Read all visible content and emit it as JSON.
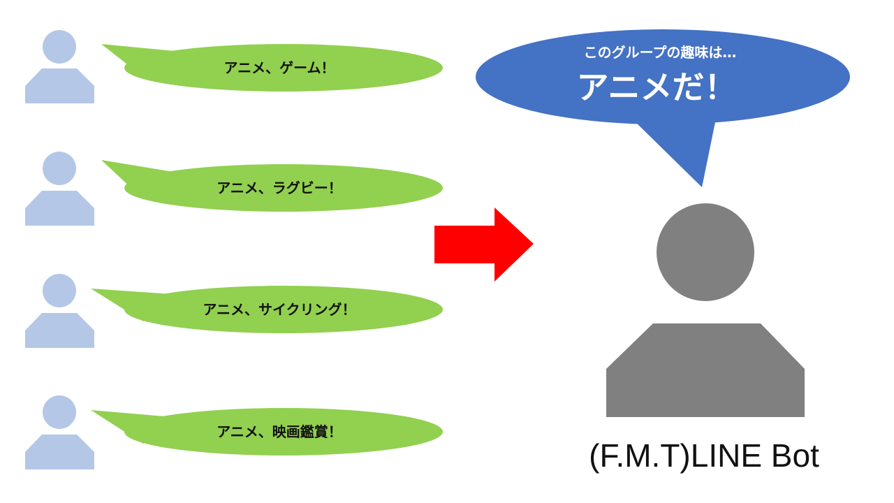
{
  "colors": {
    "user_icon": "#b4c7e7",
    "user_bubble": "#92d050",
    "arrow": "#ff0000",
    "bot_icon": "#808080",
    "bot_bubble": "#4472c4"
  },
  "users": [
    {
      "icon": "person-icon",
      "message": "アニメ、ゲーム！"
    },
    {
      "icon": "person-icon",
      "message": "アニメ、ラグビー！"
    },
    {
      "icon": "person-icon",
      "message": "アニメ、サイクリング！"
    },
    {
      "icon": "person-icon",
      "message": "アニメ、映画鑑賞！"
    }
  ],
  "arrow": {
    "icon": "arrow-right-icon"
  },
  "bot": {
    "icon": "person-icon",
    "bubble_line1": "このグループの趣味は…",
    "bubble_line2": "アニメだ！",
    "name": "(F.M.T)LINE Bot"
  }
}
